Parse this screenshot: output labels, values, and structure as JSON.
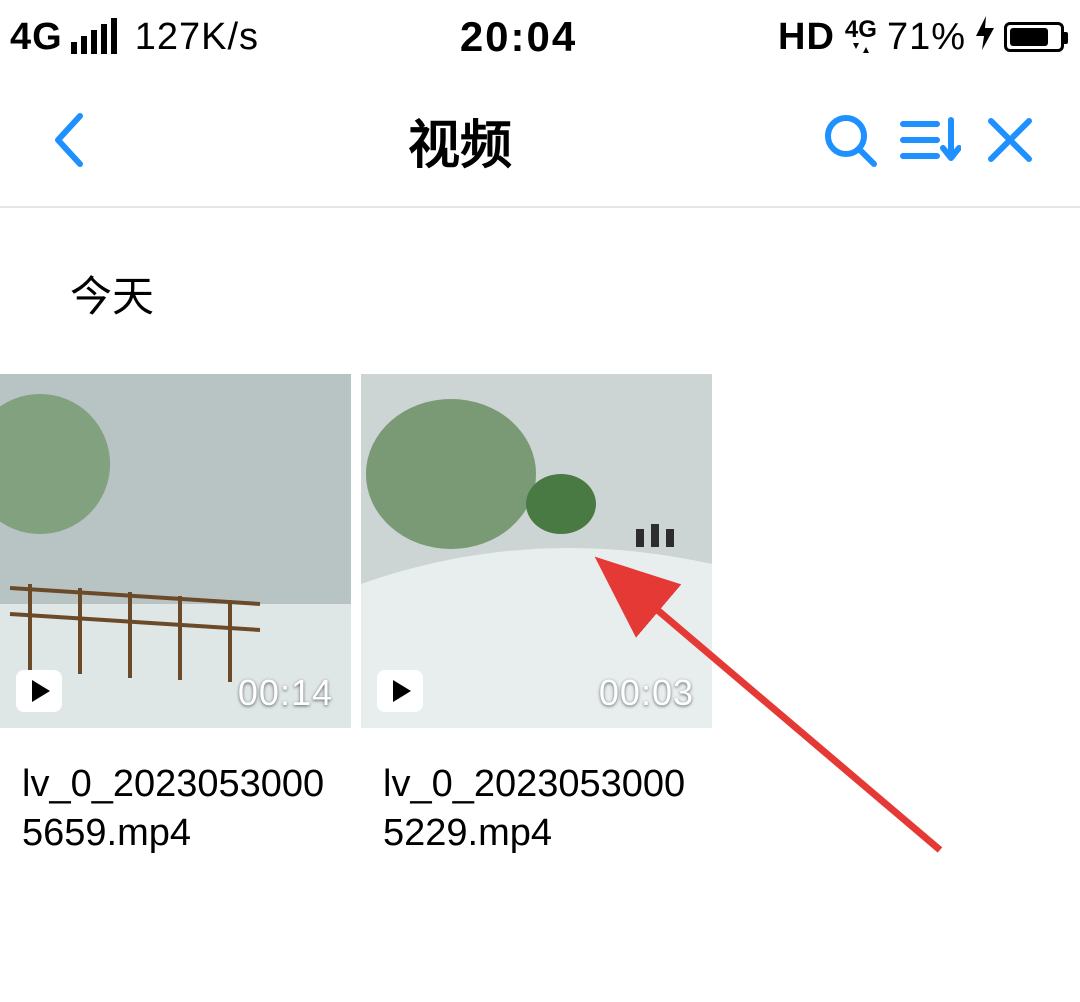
{
  "status_bar": {
    "network_type": "4G",
    "data_rate": "127K/s",
    "time": "20:04",
    "hd_label": "HD",
    "secondary_net": "4G",
    "battery_percent_text": "71%",
    "battery_fill_pct": 71
  },
  "app_bar": {
    "title": "视频"
  },
  "section": {
    "label": "今天"
  },
  "videos": [
    {
      "duration": "00:14",
      "filename": "lv_0_20230530005659.mp4"
    },
    {
      "duration": "00:03",
      "filename": "lv_0_20230530005229.mp4"
    }
  ],
  "colors": {
    "accent": "#1e90ff",
    "arrow": "#e53935"
  }
}
